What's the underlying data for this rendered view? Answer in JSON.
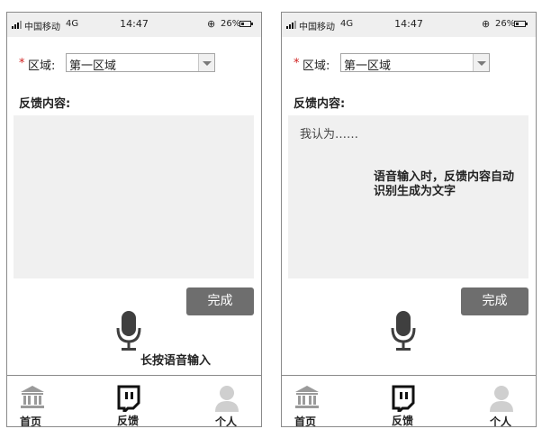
{
  "screens": [
    {
      "status_bar": {
        "carrier": "中国移动",
        "network": "4G",
        "time": "14:47",
        "battery_percent_text": "26%",
        "battery_level": 0.26,
        "orientation_lock_icon": "rotation-lock-icon"
      },
      "form": {
        "region_label": "区域:",
        "region_value": "第一区域",
        "required_mark": "*",
        "feedback_label": "反馈内容:",
        "feedback_text": "",
        "annotation": ""
      },
      "done_label": "完成",
      "voice": {
        "icon": "microphone-icon",
        "hint": "长按语音输入"
      },
      "tabs": [
        {
          "label": "首页",
          "icon": "bank-icon"
        },
        {
          "label": "反馈",
          "icon": "feedback-icon"
        },
        {
          "label": "个人",
          "icon": "person-icon"
        }
      ]
    },
    {
      "status_bar": {
        "carrier": "中国移动",
        "network": "4G",
        "time": "14:47",
        "battery_percent_text": "26%",
        "battery_level": 0.26,
        "orientation_lock_icon": "rotation-lock-icon"
      },
      "form": {
        "region_label": "区域:",
        "region_value": "第一区域",
        "required_mark": "*",
        "feedback_label": "反馈内容:",
        "feedback_text": "我认为……",
        "annotation": "语音输入时，反馈内容自动识别生成为文字"
      },
      "done_label": "完成",
      "voice": {
        "icon": "microphone-icon",
        "hint": ""
      },
      "tabs": [
        {
          "label": "首页",
          "icon": "bank-icon"
        },
        {
          "label": "反馈",
          "icon": "feedback-icon"
        },
        {
          "label": "个人",
          "icon": "person-icon"
        }
      ]
    }
  ],
  "colors": {
    "status_bar_bg": "#efefef",
    "textarea_bg": "#f0f0f0",
    "button_bg": "#6e6e6e",
    "required_star": "#d0201f",
    "icon_active": "#111111",
    "icon_inactive": "#cfcfcf",
    "icon_home": "#9a9a9a"
  }
}
